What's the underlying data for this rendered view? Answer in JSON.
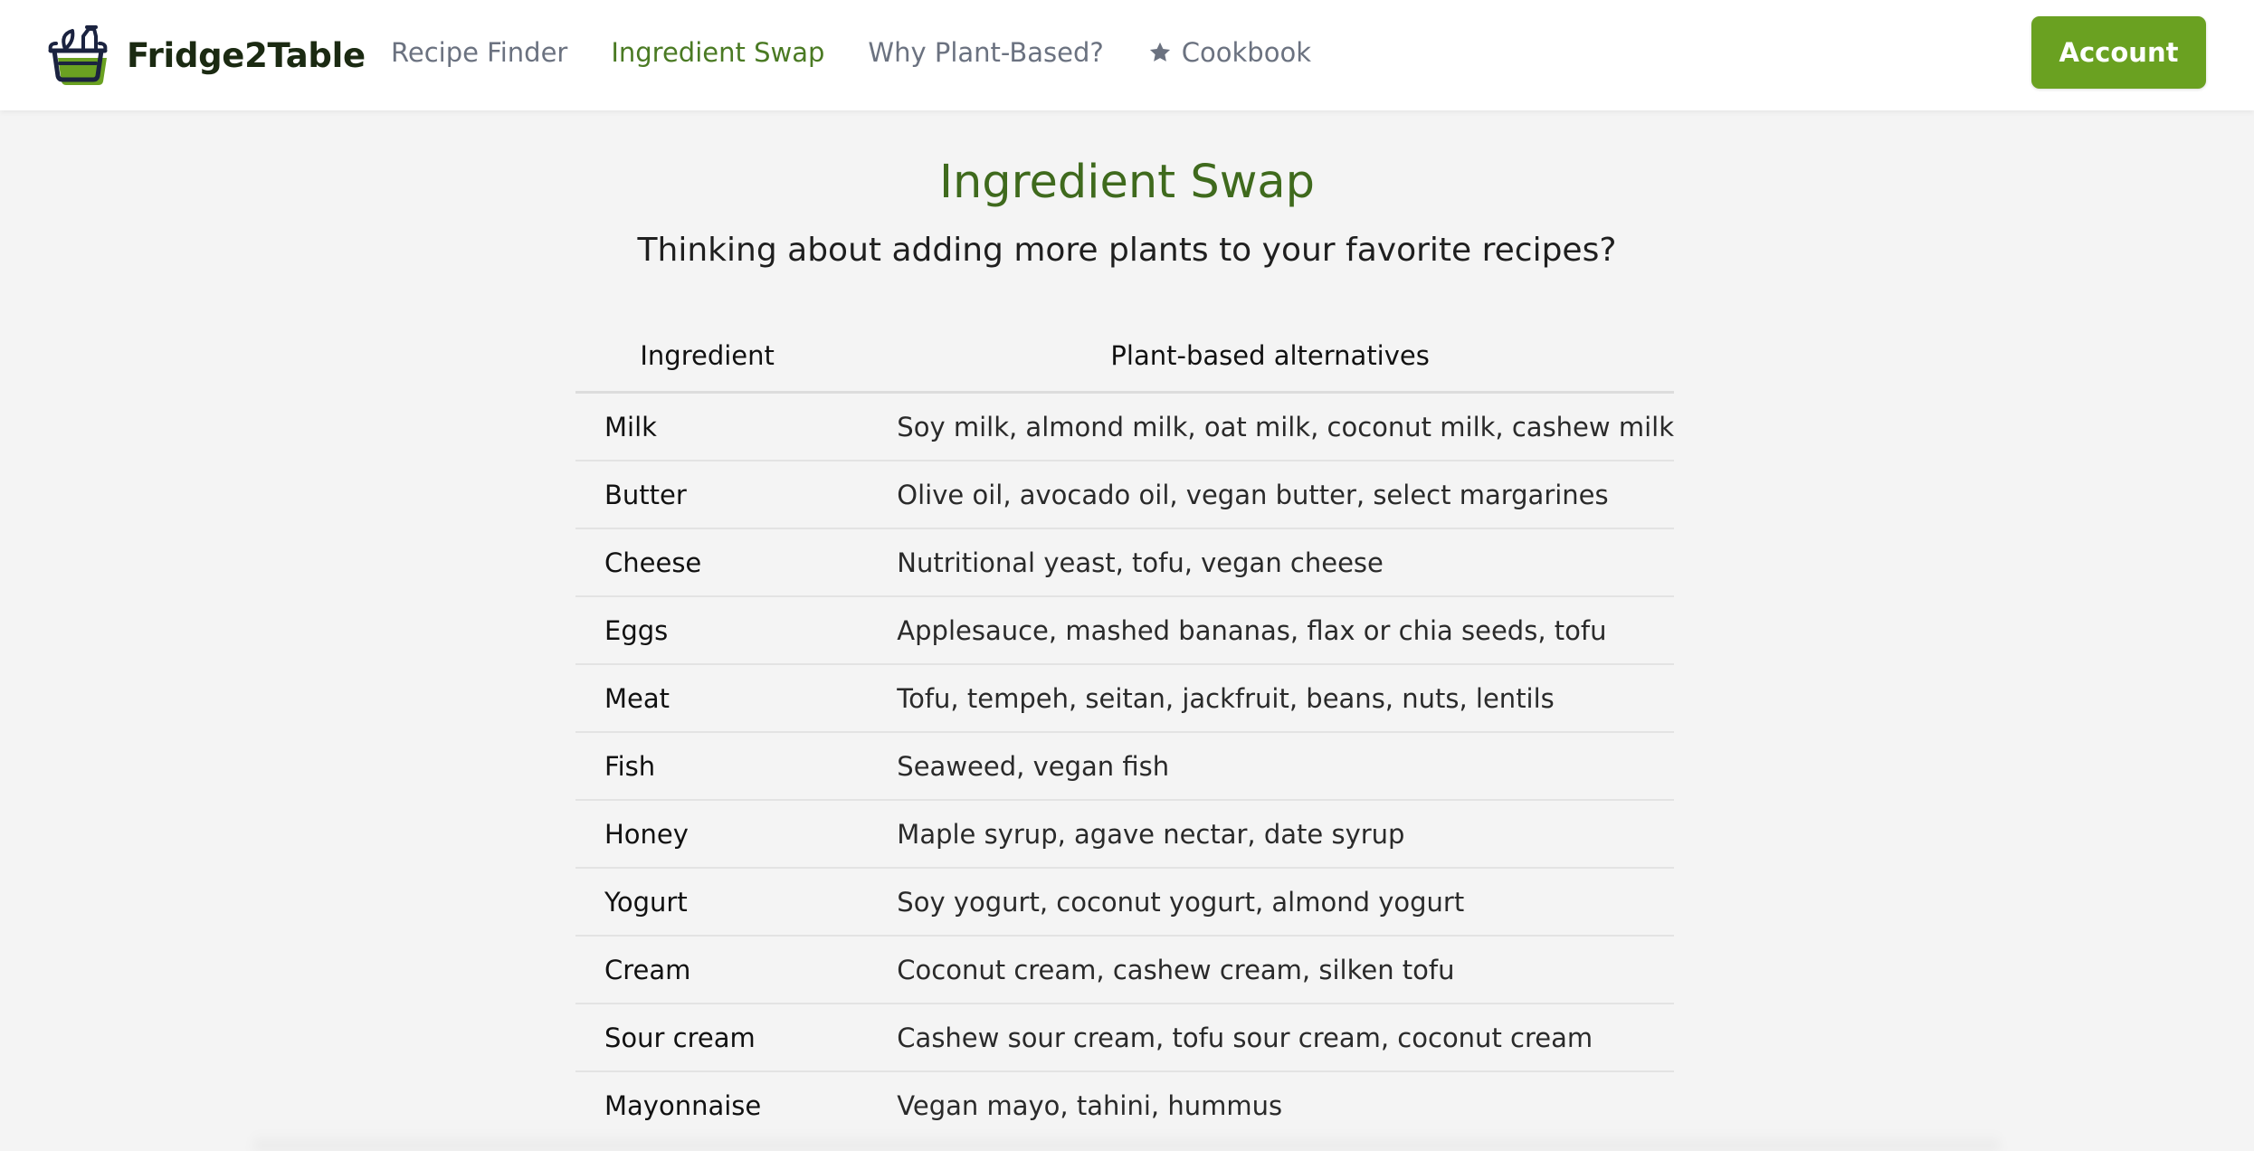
{
  "brand": {
    "name": "Fridge2Table"
  },
  "nav": {
    "links": [
      {
        "label": "Recipe Finder",
        "active": false
      },
      {
        "label": "Ingredient Swap",
        "active": true
      },
      {
        "label": "Why Plant-Based?",
        "active": false
      },
      {
        "label": "Cookbook",
        "active": false,
        "icon": "star-icon"
      }
    ],
    "account_label": "Account"
  },
  "colors": {
    "accent": "#6aa121",
    "active_link": "#4a7a23",
    "title": "#3f6a1d",
    "background": "#f4f4f4"
  },
  "main": {
    "title": "Ingredient Swap",
    "subtitle": "Thinking about adding more plants to your favorite recipes?",
    "table": {
      "headers": [
        "Ingredient",
        "Plant-based alternatives"
      ],
      "rows": [
        [
          "Milk",
          "Soy milk, almond milk, oat milk, coconut milk, cashew milk"
        ],
        [
          "Butter",
          "Olive oil, avocado oil, vegan butter, select margarines"
        ],
        [
          "Cheese",
          "Nutritional yeast, tofu, vegan cheese"
        ],
        [
          "Eggs",
          "Applesauce, mashed bananas, flax or chia seeds, tofu"
        ],
        [
          "Meat",
          "Tofu, tempeh, seitan, jackfruit, beans, nuts, lentils"
        ],
        [
          "Fish",
          "Seaweed, vegan fish"
        ],
        [
          "Honey",
          "Maple syrup, agave nectar, date syrup"
        ],
        [
          "Yogurt",
          "Soy yogurt, coconut yogurt, almond yogurt"
        ],
        [
          "Cream",
          "Coconut cream, cashew cream, silken tofu"
        ],
        [
          "Sour cream",
          "Cashew sour cream, tofu sour cream, coconut cream"
        ],
        [
          "Mayonnaise",
          "Vegan mayo, tahini, hummus"
        ]
      ]
    }
  }
}
